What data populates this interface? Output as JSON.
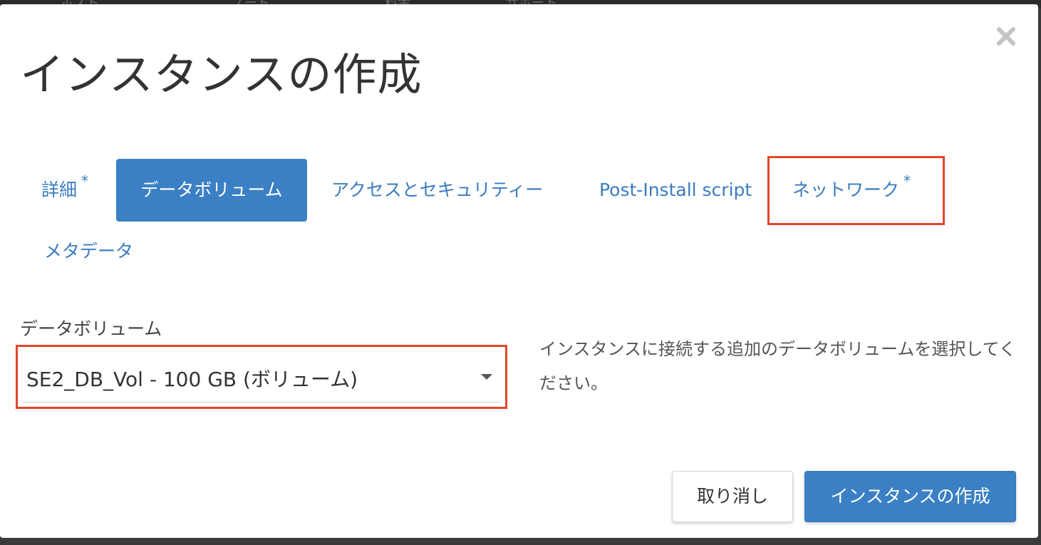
{
  "background": {
    "nav_fragments": [
      "ホスト",
      "ノード",
      "料金",
      "サポート"
    ]
  },
  "modal": {
    "title": "インスタンスの作成",
    "close_icon": "close-icon"
  },
  "tabs": [
    {
      "label": "詳細",
      "required": "*",
      "active": false
    },
    {
      "label": "データボリューム",
      "required": "",
      "active": true
    },
    {
      "label": "アクセスとセキュリティー",
      "required": "",
      "active": false
    },
    {
      "label": "Post-Install script",
      "required": "",
      "active": false
    },
    {
      "label": "ネットワーク",
      "required": "*",
      "active": false
    },
    {
      "label": "メタデータ",
      "required": "",
      "active": false
    }
  ],
  "form": {
    "data_volume_label": "データボリューム",
    "data_volume_selected": "SE2_DB_Vol - 100 GB (ボリューム)",
    "help_text": "インスタンスに接続する追加のデータボリュームを選択してください。"
  },
  "footer": {
    "cancel_label": "取り消し",
    "submit_label": "インスタンスの作成"
  },
  "colors": {
    "accent": "#3b80c4",
    "link": "#3a7cc0",
    "highlight": "#e2452c"
  }
}
